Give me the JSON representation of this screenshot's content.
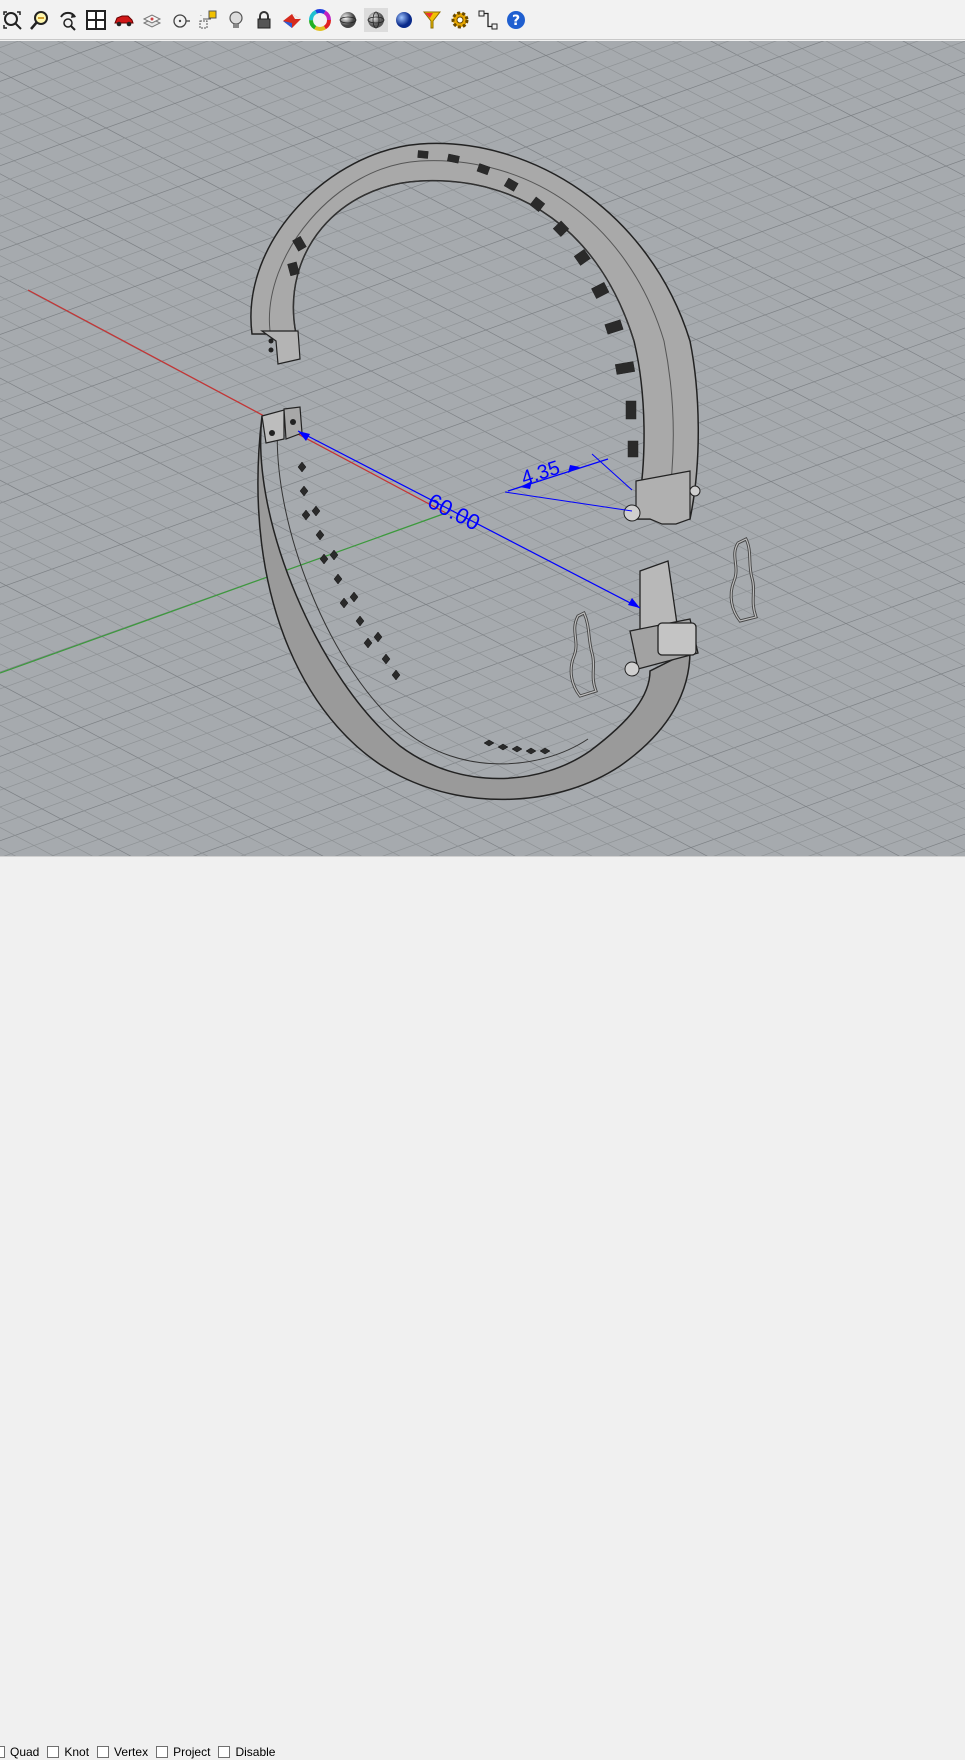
{
  "toolbar": {
    "buttons": [
      {
        "name": "zoom-extents-icon"
      },
      {
        "name": "zoom-window-icon"
      },
      {
        "name": "rotate-view-icon"
      },
      {
        "name": "four-viewports-icon"
      },
      {
        "name": "car-icon"
      },
      {
        "name": "layer-props-icon"
      },
      {
        "name": "point-snap-icon"
      },
      {
        "name": "object-snap-icon"
      },
      {
        "name": "light-bulb-icon"
      },
      {
        "name": "lock-icon"
      },
      {
        "name": "material-icon"
      },
      {
        "name": "color-wheel-icon"
      },
      {
        "name": "sphere-shaded-icon"
      },
      {
        "name": "sphere-wire-icon"
      },
      {
        "name": "sphere-render-icon"
      },
      {
        "name": "funnel-filter-icon"
      },
      {
        "name": "gear-options-icon"
      },
      {
        "name": "history-icon"
      },
      {
        "name": "help-icon"
      }
    ]
  },
  "viewport": {
    "dimensions": [
      {
        "label": "60.00",
        "color": "#0000ff"
      },
      {
        "label": "4.35",
        "color": "#0000ff"
      }
    ],
    "axis_colors": {
      "x": "#c83232",
      "y": "#3c9a3c"
    },
    "model_color": "#8d8d8d"
  },
  "osnap": {
    "items": [
      {
        "label": "Quad",
        "checked": false
      },
      {
        "label": "Knot",
        "checked": false
      },
      {
        "label": "Vertex",
        "checked": false
      },
      {
        "label": "Project",
        "checked": false
      },
      {
        "label": "Disable",
        "checked": false
      }
    ]
  }
}
